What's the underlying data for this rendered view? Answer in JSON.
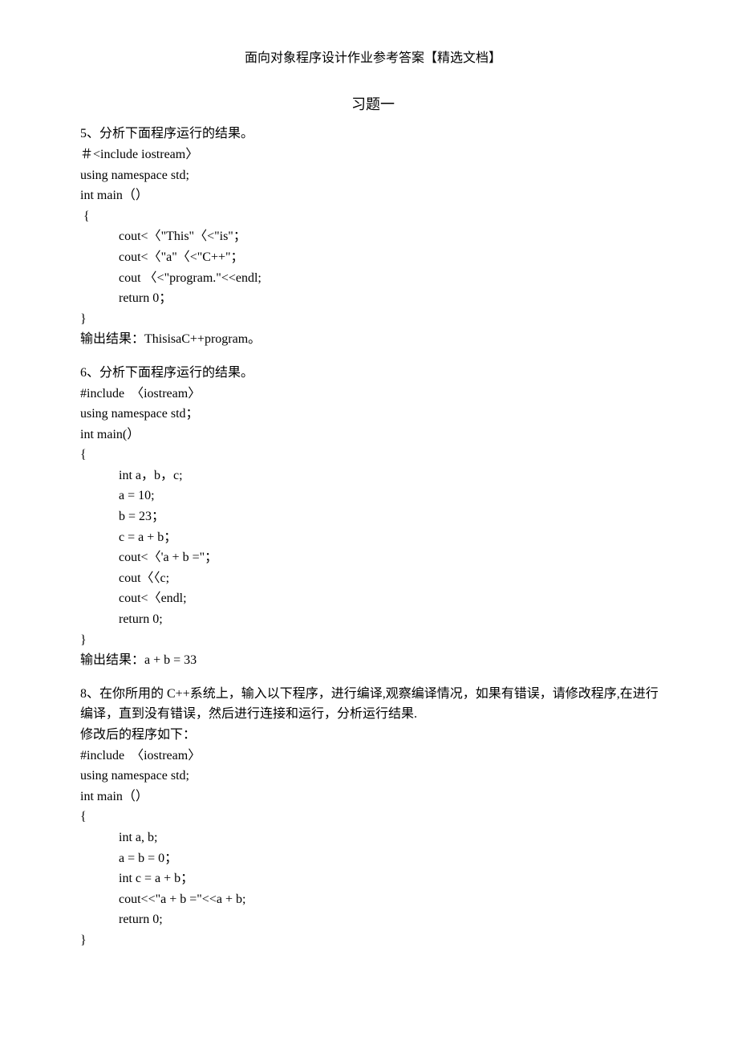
{
  "header": "面向对象程序设计作业参考答案【精选文档】",
  "title": "习题一",
  "q5": {
    "heading": "5、分析下面程序运行的结果。",
    "code": [
      "＃<include iostream〉",
      "using namespace std;",
      "int main（）",
      " {",
      "cout<〈\"This\"〈<\"is\"；",
      "cout<〈\"a\"〈<\"C++\"；",
      "cout 〈<\"program.\"<<endl;",
      "return 0；"
    ],
    "close": "}",
    "output": "输出结果：ThisisaC++program。"
  },
  "q6": {
    "heading": "6、分析下面程序运行的结果。",
    "code": [
      "#include  〈iostream〉",
      "using namespace std；",
      "int main(）",
      "{",
      "int a，b，c;",
      "a = 10;",
      "b = 23；",
      "c = a + b；",
      "cout<〈'a + b =\"；",
      "cout〈〈c;",
      "cout<〈endl;",
      "return 0;"
    ],
    "close": "}",
    "output": "输出结果：a + b = 33"
  },
  "q8": {
    "heading": "8、在你所用的 C++系统上，输入以下程序，进行编译,观察编译情况，如果有错误，请修改程序,在进行编译，直到没有错误，然后进行连接和运行，分析运行结果.",
    "subheading": "修改后的程序如下：",
    "code": [
      "#include  〈iostream〉",
      "using namespace std;",
      "int main（）",
      "{",
      "int a, b;",
      "a = b = 0；",
      "int c = a + b；",
      "cout<<\"a + b =\"<<a + b;",
      "return 0;"
    ],
    "close": "}"
  }
}
